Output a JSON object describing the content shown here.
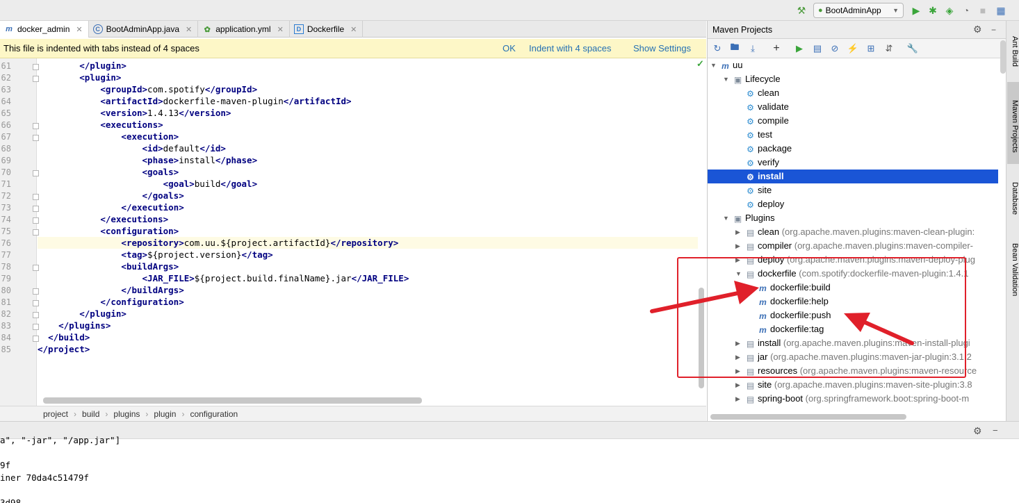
{
  "toolbar": {
    "run_config": "BootAdminApp",
    "icons": [
      "hammer-icon",
      "run-config-icon",
      "run-icon",
      "debug-icon",
      "coverage-icon",
      "stop-icon",
      "project-structure-icon"
    ]
  },
  "tabs": [
    {
      "label": "docker_admin",
      "icon": "m",
      "active": true
    },
    {
      "label": "BootAdminApp.java",
      "icon": "C",
      "active": false
    },
    {
      "label": "application.yml",
      "icon": "y",
      "active": false
    },
    {
      "label": "Dockerfile",
      "icon": "D",
      "active": false
    }
  ],
  "notification": {
    "message": "This file is indented with tabs instead of 4 spaces",
    "ok": "OK",
    "indent": "Indent with 4 spaces",
    "settings": "Show Settings"
  },
  "editor": {
    "lines": [
      {
        "n": "61",
        "text": "        </plugin>"
      },
      {
        "n": "62",
        "text": "        <plugin>"
      },
      {
        "n": "63",
        "text": "            <groupId>com.spotify</groupId>"
      },
      {
        "n": "64",
        "text": "            <artifactId>dockerfile-maven-plugin</artifactId>"
      },
      {
        "n": "65",
        "text": "            <version>1.4.13</version>"
      },
      {
        "n": "66",
        "text": "            <executions>"
      },
      {
        "n": "67",
        "text": "                <execution>"
      },
      {
        "n": "68",
        "text": "                    <id>default</id>"
      },
      {
        "n": "69",
        "text": "                    <phase>install</phase>"
      },
      {
        "n": "70",
        "text": "                    <goals>"
      },
      {
        "n": "71",
        "text": "                        <goal>build</goal>"
      },
      {
        "n": "72",
        "text": "                    </goals>"
      },
      {
        "n": "73",
        "text": "                </execution>"
      },
      {
        "n": "74",
        "text": "            </executions>"
      },
      {
        "n": "75",
        "text": "            <configuration>"
      },
      {
        "n": "76",
        "text": "                <repository>com.uu.${project.artifactId}</repository>"
      },
      {
        "n": "77",
        "text": "                <tag>${project.version}</tag>"
      },
      {
        "n": "78",
        "text": "                <buildArgs>"
      },
      {
        "n": "79",
        "text": "                    <JAR_FILE>${project.build.finalName}.jar</JAR_FILE>"
      },
      {
        "n": "80",
        "text": "                </buildArgs>"
      },
      {
        "n": "81",
        "text": "            </configuration>"
      },
      {
        "n": "82",
        "text": "        </plugin>"
      },
      {
        "n": "83",
        "text": "    </plugins>"
      },
      {
        "n": "84",
        "text": "  </build>"
      },
      {
        "n": "85",
        "text": "</project>"
      }
    ],
    "current_line": "76"
  },
  "breadcrumb": [
    "project",
    "build",
    "plugins",
    "plugin",
    "configuration"
  ],
  "maven": {
    "title": "Maven Projects",
    "tree": [
      {
        "depth": 0,
        "arrow": "down",
        "icon": "m",
        "label": "uu",
        "sub": ""
      },
      {
        "depth": 1,
        "arrow": "down",
        "icon": "folder",
        "label": "Lifecycle",
        "sub": ""
      },
      {
        "depth": 2,
        "arrow": "",
        "icon": "gear",
        "label": "clean",
        "sub": ""
      },
      {
        "depth": 2,
        "arrow": "",
        "icon": "gear",
        "label": "validate",
        "sub": ""
      },
      {
        "depth": 2,
        "arrow": "",
        "icon": "gear",
        "label": "compile",
        "sub": ""
      },
      {
        "depth": 2,
        "arrow": "",
        "icon": "gear",
        "label": "test",
        "sub": ""
      },
      {
        "depth": 2,
        "arrow": "",
        "icon": "gear",
        "label": "package",
        "sub": ""
      },
      {
        "depth": 2,
        "arrow": "",
        "icon": "gear",
        "label": "verify",
        "sub": ""
      },
      {
        "depth": 2,
        "arrow": "",
        "icon": "gear",
        "label": "install",
        "sub": "",
        "selected": true
      },
      {
        "depth": 2,
        "arrow": "",
        "icon": "gear",
        "label": "site",
        "sub": ""
      },
      {
        "depth": 2,
        "arrow": "",
        "icon": "gear",
        "label": "deploy",
        "sub": ""
      },
      {
        "depth": 1,
        "arrow": "down",
        "icon": "folder",
        "label": "Plugins",
        "sub": ""
      },
      {
        "depth": 2,
        "arrow": "right",
        "icon": "plugin",
        "label": "clean",
        "sub": "(org.apache.maven.plugins:maven-clean-plugin:"
      },
      {
        "depth": 2,
        "arrow": "right",
        "icon": "plugin",
        "label": "compiler",
        "sub": "(org.apache.maven.plugins:maven-compiler-"
      },
      {
        "depth": 2,
        "arrow": "right",
        "icon": "plugin",
        "label": "deploy",
        "sub": "(org.apache.maven.plugins:maven-deploy-plug"
      },
      {
        "depth": 2,
        "arrow": "down",
        "icon": "plugin",
        "label": "dockerfile",
        "sub": "(com.spotify:dockerfile-maven-plugin:1.4.1"
      },
      {
        "depth": 3,
        "arrow": "",
        "icon": "goal",
        "label": "dockerfile:build",
        "sub": ""
      },
      {
        "depth": 3,
        "arrow": "",
        "icon": "goal",
        "label": "dockerfile:help",
        "sub": ""
      },
      {
        "depth": 3,
        "arrow": "",
        "icon": "goal",
        "label": "dockerfile:push",
        "sub": ""
      },
      {
        "depth": 3,
        "arrow": "",
        "icon": "goal",
        "label": "dockerfile:tag",
        "sub": ""
      },
      {
        "depth": 2,
        "arrow": "right",
        "icon": "plugin",
        "label": "install",
        "sub": "(org.apache.maven.plugins:maven-install-plugi"
      },
      {
        "depth": 2,
        "arrow": "right",
        "icon": "plugin",
        "label": "jar",
        "sub": "(org.apache.maven.plugins:maven-jar-plugin:3.1.2"
      },
      {
        "depth": 2,
        "arrow": "right",
        "icon": "plugin",
        "label": "resources",
        "sub": "(org.apache.maven.plugins:maven-resource"
      },
      {
        "depth": 2,
        "arrow": "right",
        "icon": "plugin",
        "label": "site",
        "sub": "(org.apache.maven.plugins:maven-site-plugin:3.8"
      },
      {
        "depth": 2,
        "arrow": "right",
        "icon": "plugin",
        "label": "spring-boot",
        "sub": "(org.springframework.boot:spring-boot-m"
      }
    ]
  },
  "side_tabs": [
    {
      "label": "Ant Build",
      "active": false
    },
    {
      "label": "Maven Projects",
      "active": true
    },
    {
      "label": "Database",
      "active": false
    },
    {
      "label": "Bean Validation",
      "active": false
    }
  ],
  "console": {
    "lines": [
      "a\", \"-jar\", \"/app.jar\"]",
      "",
      "9f",
      "iner 70da4c51479f",
      "",
      "3d98"
    ]
  },
  "colors": {
    "selection": "#1a55d6",
    "annotation": "#e0202a",
    "tag": "#000080",
    "notification_bg": "#fdf7c7"
  }
}
